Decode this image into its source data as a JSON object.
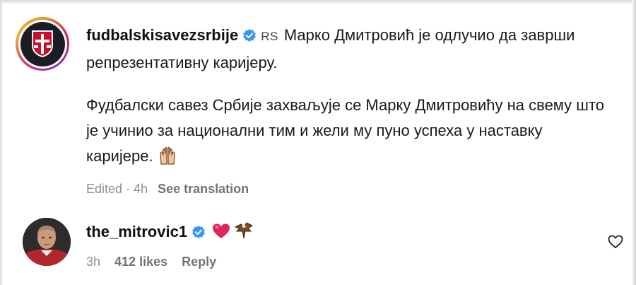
{
  "caption": {
    "username": "fudbalskisavezsrbije",
    "flag": "RS",
    "paragraph1": "Марко Дмитровић је одлучио да заврши репрезентативну каријеру.",
    "paragraph2": "Фудбалски савез Србије захваљује се Марку Дмитровићу на свему што је учинио за национални тим и жели му пуно успеха у наставку каријере.",
    "edited_time": "Edited · 4h",
    "see_translation": "See translation",
    "icons": [
      "fss-crest-avatar",
      "verified-badge-icon",
      "raised-hands-emoji"
    ]
  },
  "comment": {
    "username": "the_mitrovic1",
    "emojis": [
      "red-heart-emoji",
      "eagle-emoji"
    ],
    "time": "3h",
    "likes": "412 likes",
    "reply": "Reply",
    "icons": [
      "player-avatar",
      "verified-badge-icon",
      "heart-outline-icon"
    ]
  },
  "colors": {
    "verified": "#3897f0",
    "muted_text": "#8e8e8e",
    "heart": "#e0245e"
  }
}
